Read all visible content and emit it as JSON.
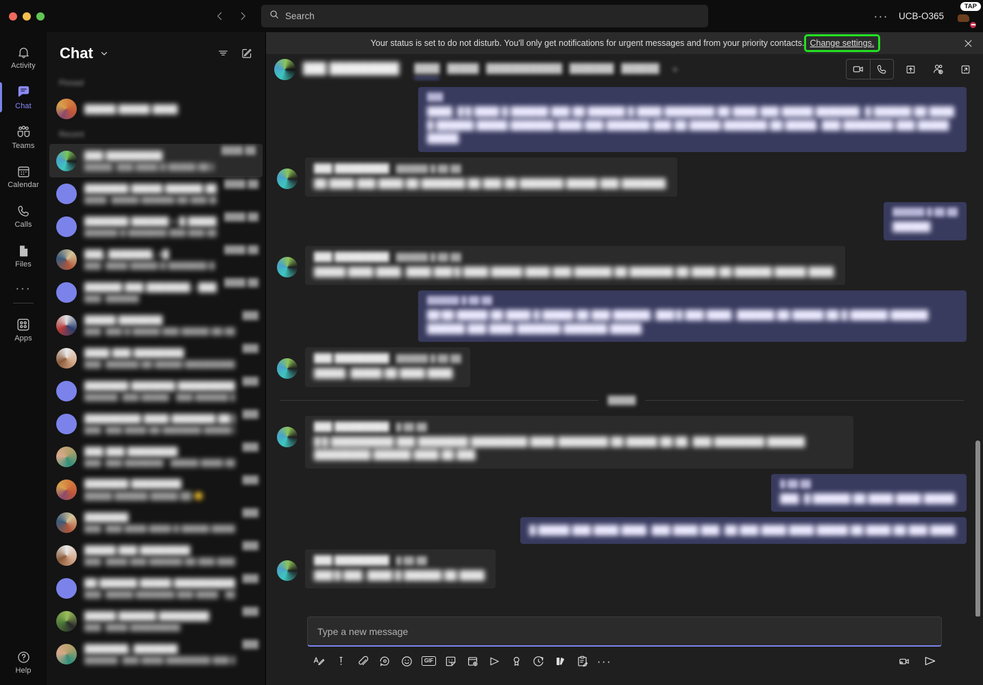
{
  "window": {
    "traffic_lights": [
      "close",
      "minimize",
      "maximize"
    ],
    "nav_back": "back-arrow",
    "nav_forward": "forward-arrow"
  },
  "search": {
    "placeholder": "Search",
    "icon": "search-icon",
    "value": ""
  },
  "titlebar": {
    "more_label": "···",
    "org_name": "UCB-O365",
    "avatar_tooltip": "TAP",
    "presence": "do-not-disturb",
    "presence_color": "#c4314b"
  },
  "rail": {
    "items": [
      {
        "label": "Activity",
        "icon": "bell-icon",
        "active": false
      },
      {
        "label": "Chat",
        "icon": "chat-bubble-icon",
        "active": true
      },
      {
        "label": "Teams",
        "icon": "teams-people-icon",
        "active": false
      },
      {
        "label": "Calendar",
        "icon": "calendar-icon",
        "active": false
      },
      {
        "label": "Calls",
        "icon": "phone-icon",
        "active": false
      },
      {
        "label": "Files",
        "icon": "file-icon",
        "active": false
      }
    ],
    "more_label": "···",
    "apps": {
      "label": "Apps",
      "icon": "apps-grid-icon"
    },
    "help": {
      "label": "Help",
      "icon": "question-circle-icon"
    },
    "active_accent": "#7b83eb"
  },
  "chat_list": {
    "title": "Chat",
    "caret_icon": "chevron-down-icon",
    "filter_icon": "filter-icon",
    "compose_icon": "compose-icon",
    "sections": [
      {
        "label": "Pinned"
      },
      {
        "label": "Recent"
      }
    ],
    "pinned": [
      {
        "name": "█████ █████ ████",
        "preview": "",
        "time": "",
        "avatar": "g1"
      }
    ],
    "recent": [
      {
        "name": "███ █████████",
        "preview": "█████: ███ ████ █ █████ ██ ████",
        "time": "████ ██",
        "avatar": "g2",
        "selected": true
      },
      {
        "name": "███████ █████ ██████ █████",
        "preview": "████: █████ ██████ ██ ███ ████ ████",
        "time": "████ ██",
        "avatar": "purple"
      },
      {
        "name": "███████ ██████ + █ ████████",
        "preview": "██████ █ ███████ ███ ███ ██████",
        "time": "████ ██",
        "avatar": "purple"
      },
      {
        "name": "███, ███████, +█",
        "preview": "███: ████ █████ █ ███████ █ ████ ██",
        "time": "████ ██",
        "avatar": "g6"
      },
      {
        "name": "██████ ███ ███████ - ████",
        "preview": "███: ██████",
        "time": "████ ██",
        "avatar": "purple"
      },
      {
        "name": "█████ ███████",
        "preview": "███: ███ █ █████ ███ █████ ██ ███ ███ ███",
        "time": "███",
        "avatar": "g4"
      },
      {
        "name": "████ ███ ████████",
        "preview": "███: ██████ ██ █████ ██████████ █████ █",
        "time": "███",
        "avatar": "g3"
      },
      {
        "name": "███████ ███████ ██████████",
        "preview": "██████: ███ █████ - ███ ██████ ██████",
        "time": "███",
        "avatar": "purple"
      },
      {
        "name": "█████████ ████ ███████ ██ █",
        "preview": "███: ███ ████ ██ ███████ █████ ████",
        "time": "███",
        "avatar": "purple"
      },
      {
        "name": "███ ███ ████████",
        "preview": "███: ███ ███████ - █████ ████ ████████",
        "time": "███",
        "avatar": "g7"
      },
      {
        "name": "███████ ████████",
        "preview": "█████ ██████ █████ ██ 😊",
        "time": "███",
        "avatar": "g1"
      },
      {
        "name": "███████",
        "preview": "███: ███ ████ ████ █ █████ █████ ███",
        "time": "███",
        "avatar": "g6"
      },
      {
        "name": "█████ ███ ████████",
        "preview": "███: ████ ███ ██████ ██ ███ ██████",
        "time": "███",
        "avatar": "g3"
      },
      {
        "name": "██ ██████ █████ ████████████",
        "preview": "███: █████ ███████ ███ ████ - █████████",
        "time": "███",
        "avatar": "purple"
      },
      {
        "name": "█████ ██████ ████████",
        "preview": "███: ████ █████████",
        "time": "███",
        "avatar": "g5"
      },
      {
        "name": "███████, ███████",
        "preview": "██████: ███ ████ ████████ ███ ██████",
        "time": "███",
        "avatar": "g7"
      }
    ]
  },
  "banner": {
    "text": "Your status is set to do not disturb. You'll only get notifications for urgent messages and from your priority contacts.",
    "link_label": "Change settings.",
    "highlight_color": "#22e022",
    "close_icon": "close-icon"
  },
  "chat_header": {
    "contact_name": "███ █████████",
    "tabs": [
      {
        "label": "████",
        "active": true
      },
      {
        "label": "█████",
        "active": false
      },
      {
        "label": "████████████",
        "active": false
      },
      {
        "label": "███████",
        "active": false
      },
      {
        "label": "██████",
        "active": false
      }
    ],
    "add_tab_label": "+",
    "actions": [
      {
        "name": "video-call",
        "icon": "video-camera-icon"
      },
      {
        "name": "audio-call",
        "icon": "phone-icon"
      },
      {
        "name": "share-screen",
        "icon": "share-up-icon"
      },
      {
        "name": "add-people",
        "icon": "add-person-icon"
      },
      {
        "name": "pop-out",
        "icon": "open-external-icon"
      }
    ]
  },
  "messages": [
    {
      "direction": "out",
      "name": "",
      "time": "███",
      "text": "████, █'█ ████ █ ██████ ███ ██ ██████ █ ████ ████████ ██ ████ ███ █████ ███████. █ ██████ ██ ████ █ ██████ █████ ███████ ████ ███ ███████ ███ ██ █████ ███████ ██ █████, ███ ████████ ███ █████ █████."
    },
    {
      "direction": "in",
      "name": "███ █████████",
      "time": "██████ █:██ ██",
      "text": "██ ████ ███ ████ ██ ███████ ██ ███ ██ ███████ █████ ███ ███████."
    },
    {
      "direction": "out",
      "name": "",
      "time": "██████ █:██ ██",
      "text": "██████"
    },
    {
      "direction": "in",
      "name": "███ █████████",
      "time": "██████ █:██ ██",
      "text": "█████ ████ ████, ████ ███'█ ████ █████ ████ ███ ██████ ██ ███████ ██ ████ ██ ██████ █████ ████."
    },
    {
      "direction": "out",
      "name": "",
      "time": "██████ █:██ ██",
      "text": "██'██ █████ ██ ████ █ █████ ██ ███ ██████. ███'█ ███ ████. ██████ ██ █████ ██ █ ██████ ██████ ██████ ███ ████ ███████ ███████ █████."
    },
    {
      "direction": "in",
      "name": "███ █████████",
      "time": "██████ █:██ ██",
      "text": "█████, █████ ██ ████ ████."
    }
  ],
  "day_divider": {
    "label": "█████"
  },
  "messages_today": [
    {
      "direction": "in",
      "name": "███ █████████",
      "time": "█:██ ██",
      "text": "█'█ ██████████ ███ ████████ █████████ ████ ████████ ██ █████ ██ ██, ███ ████████ ██████ █████████ ██████ ████ ██ ███."
    },
    {
      "direction": "out",
      "name": "",
      "time": "█:██ ██",
      "text": "███, █ ██████ ██ ████ ████ █████."
    },
    {
      "direction": "out",
      "name": "",
      "time": "",
      "text": "█ █████ ███ ████ ████. ███ ████ ███. ██ ███ ████ ████ █████ ██ ████ ██ ███ ████."
    },
    {
      "direction": "in",
      "name": "███ █████████",
      "time": "█:██ ██",
      "text": "███'█ ███, ████ █ ██████ ██ ████."
    }
  ],
  "composer": {
    "placeholder": "Type a new message",
    "toolbar": [
      {
        "name": "format-text",
        "icon": "format-text-icon"
      },
      {
        "name": "set-delivery-options",
        "icon": "importance-icon"
      },
      {
        "name": "attach-file",
        "icon": "paperclip-icon"
      },
      {
        "name": "loop-component",
        "icon": "loop-icon"
      },
      {
        "name": "emoji",
        "icon": "emoji-icon"
      },
      {
        "name": "giphy",
        "icon": "gif-icon",
        "text": "GIF"
      },
      {
        "name": "sticker",
        "icon": "sticker-icon"
      },
      {
        "name": "schedule-meeting",
        "icon": "calendar-add-icon"
      },
      {
        "name": "stream-video",
        "icon": "stream-icon"
      },
      {
        "name": "praise",
        "icon": "award-icon"
      },
      {
        "name": "approvals",
        "icon": "approvals-clock-icon"
      },
      {
        "name": "shifts",
        "icon": "shifts-icon"
      },
      {
        "name": "forms",
        "icon": "forms-icon"
      },
      {
        "name": "more-options",
        "icon": "more-horizontal-icon",
        "text": "···"
      }
    ],
    "right_actions": [
      {
        "name": "record-video-clip",
        "icon": "video-clip-icon"
      },
      {
        "name": "send-message",
        "icon": "send-icon"
      }
    ],
    "focus_color": "#7b83eb"
  }
}
